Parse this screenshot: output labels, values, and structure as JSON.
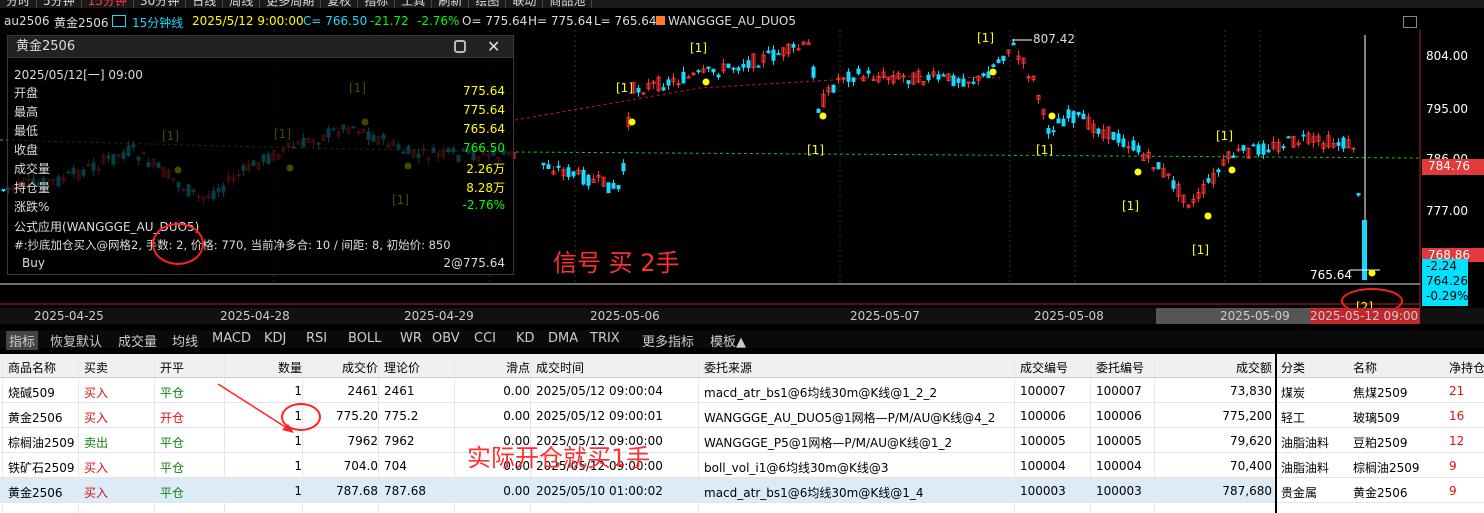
{
  "top_tabs": [
    "分时",
    "5分钟",
    "15分钟",
    "30分钟",
    "日线",
    "周线",
    "更多周期",
    "复权",
    "指标",
    "工具",
    "刷新",
    "绘图",
    "联动",
    "商品池"
  ],
  "info_bar": {
    "symbol": "au2506",
    "name": "黄金2506",
    "period_label": "15分钟线",
    "datetime": "2025/5/12 9:00:00",
    "close": "C= 766.50",
    "change": "-21.72",
    "change_pct": "-2.76%",
    "open": "O= 775.64",
    "high": "H= 775.64",
    "low": "L= 765.64",
    "strategy": "WANGGGE_AU_DUO5"
  },
  "price_axis": {
    "labels": [
      "804.00",
      "795.00",
      "786.00",
      "777.00",
      "768.86"
    ],
    "current": "784.76",
    "box": [
      "-2.24",
      "764.26",
      "-0.29%"
    ]
  },
  "chart_annotations": {
    "high_label": "807.42",
    "low_label": "765.64",
    "signal_marks": [
      "[1]",
      "[1]",
      "[1]",
      "[1]",
      "[1]",
      "[1]",
      "[1]",
      "[1]",
      "[1]",
      "[1]",
      "[2]"
    ]
  },
  "popup": {
    "title": "黄金2506",
    "date": "2025/05/12[一] 09:00",
    "rows": [
      {
        "label": "开盘",
        "value": "775.64"
      },
      {
        "label": "最高",
        "value": "775.64"
      },
      {
        "label": "最低",
        "value": "765.64"
      },
      {
        "label": "收盘",
        "value": "766.50"
      },
      {
        "label": "成交量",
        "value": "2.26万"
      },
      {
        "label": "持仓量",
        "value": "8.28万"
      },
      {
        "label": "涨跌%",
        "value": "-2.76%"
      }
    ],
    "formula": "公式应用(WANGGGE_AU_DUO5)",
    "signal_text": "#:抄底加仓买入@网格2, 手数: 2, 价格: 770, 当前净多合: 10 / 间距: 8, 初始价: 850",
    "action_label": "Buy",
    "action_value": "2@775.64"
  },
  "annotation_signal": "信号 买 2手",
  "annotation_actual": "实际开仓就买1手",
  "dates": [
    "2025-04-25",
    "2025-04-28",
    "2025-04-29",
    "2025-05-06",
    "2025-05-07",
    "2025-05-08",
    "2025-05-09",
    "2025-05-12 09:00"
  ],
  "indicator_tabs": [
    "指标",
    "恢复默认",
    "成交量",
    "均线",
    "MACD",
    "KDJ",
    "RSI",
    "BOLL",
    "WR",
    "OBV",
    "CCI",
    "KD",
    "DMA",
    "TRIX",
    "更多指标",
    "模板▲"
  ],
  "table": {
    "headers": [
      "商品名称",
      "买卖",
      "开平",
      "数量",
      "成交价",
      "理论价",
      "滑点",
      "成交时间",
      "委托来源",
      "成交编号",
      "委托编号",
      "成交额"
    ],
    "rows": [
      [
        "烧碱509",
        "买入",
        "平仓",
        "1",
        "2461",
        "2461",
        "0.00",
        "2025/05/12 09:00:04",
        "macd_atr_bs1@6均线30m@K线@1_2_2",
        "100007",
        "100007",
        "73,830"
      ],
      [
        "黄金2506",
        "买入",
        "开仓",
        "1",
        "775.20",
        "775.2",
        "0.00",
        "2025/05/12 09:00:01",
        "WANGGGE_AU_DUO5@1网格—P/M/AU@K线@4_2",
        "100006",
        "100006",
        "775,200"
      ],
      [
        "棕榈油2509",
        "卖出",
        "平仓",
        "1",
        "7962",
        "7962",
        "0.00",
        "2025/05/12 09:00:00",
        "WANGGGE_P5@1网格—P/M/AU@K线@1_2",
        "100005",
        "100005",
        "79,620"
      ],
      [
        "铁矿石2509",
        "买入",
        "平仓",
        "1",
        "704.0",
        "704",
        "0.00",
        "2025/05/12 09:00:00",
        "boll_vol_i1@6均线30m@K线@3",
        "100004",
        "100004",
        "70,400"
      ],
      [
        "黄金2506",
        "买入",
        "平仓",
        "1",
        "787.68",
        "787.68",
        "0.00",
        "2025/05/10 01:00:02",
        "macd_atr_bs1@6均线30m@K线@1_4",
        "100003",
        "100003",
        "787,680"
      ]
    ]
  },
  "right_panel": {
    "headers": [
      "分类",
      "名称",
      "净持仓"
    ],
    "rows": [
      [
        "煤炭",
        "焦煤2509",
        "21"
      ],
      [
        "轻工",
        "玻璃509",
        "16"
      ],
      [
        "油脂油料",
        "豆粕2509",
        "12"
      ],
      [
        "油脂油料",
        "棕榈油2509",
        "9"
      ],
      [
        "贵金属",
        "黄金2506",
        "9"
      ]
    ]
  },
  "colors": {
    "up": "#ff3232",
    "down": "#19d9ff",
    "yellow": "#ffff00",
    "green": "#00ff00",
    "bg": "#000000"
  }
}
